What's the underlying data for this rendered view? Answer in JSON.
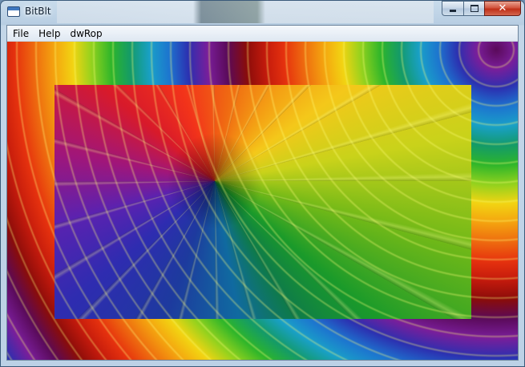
{
  "window": {
    "title": "BitBlt"
  },
  "menu": {
    "items": [
      "File",
      "Help",
      "dwRop"
    ]
  },
  "caption": {
    "close_glyph": "✕"
  }
}
